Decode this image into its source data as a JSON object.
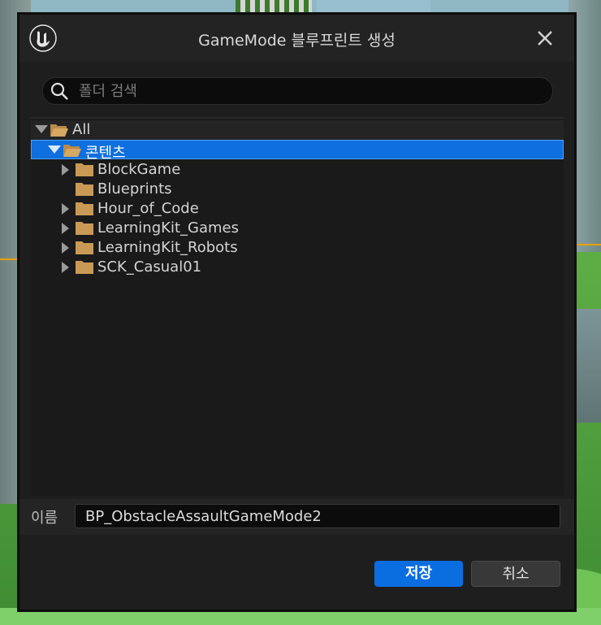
{
  "dialog": {
    "title": "GameMode 블루프린트 생성",
    "logo_icon": "unreal-engine-logo",
    "close_icon": "close-icon"
  },
  "search": {
    "placeholder": "폴더 검색",
    "value": ""
  },
  "tree": {
    "root": {
      "label": "All",
      "expanded": true
    },
    "content": {
      "label": "콘텐츠",
      "expanded": true,
      "selected": true
    },
    "items": [
      {
        "label": "BlockGame",
        "has_children": true
      },
      {
        "label": "Blueprints",
        "has_children": false
      },
      {
        "label": "Hour_of_Code",
        "has_children": true
      },
      {
        "label": "LearningKit_Games",
        "has_children": true
      },
      {
        "label": "LearningKit_Robots",
        "has_children": true
      },
      {
        "label": "SCK_Casual01",
        "has_children": true
      }
    ]
  },
  "name_field": {
    "label": "이름",
    "value": "BP_ObstacleAssaultGameMode2"
  },
  "buttons": {
    "save": "저장",
    "cancel": "취소"
  },
  "colors": {
    "selection": "#0f6fde",
    "primary_button": "#0a6ee0",
    "folder": "#c99a55"
  }
}
